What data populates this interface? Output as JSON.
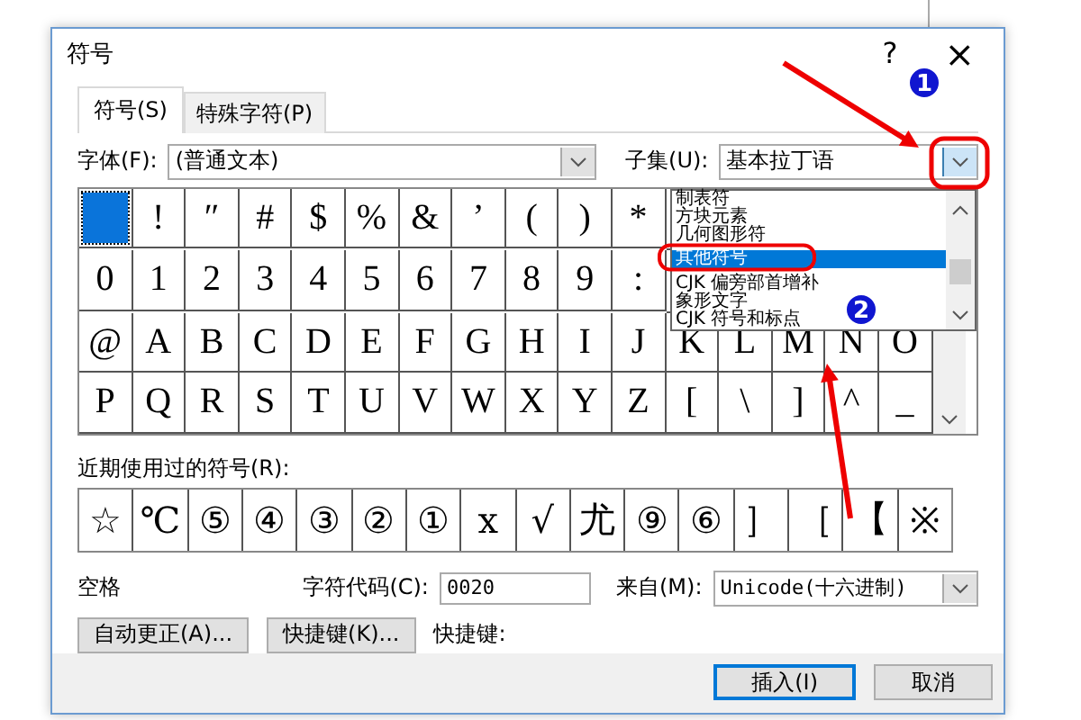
{
  "window": {
    "title": "符号",
    "help": "?",
    "close": "×"
  },
  "tabs": [
    {
      "label": "符号(S)",
      "selected": true
    },
    {
      "label": "特殊字符(P)",
      "selected": false
    }
  ],
  "font": {
    "label": "字体(F):",
    "value": "(普通文本)"
  },
  "subset": {
    "label": "子集(U):",
    "value": "基本拉丁语",
    "expanded": true,
    "options": [
      {
        "label": "制表符",
        "selected": false
      },
      {
        "label": "方块元素",
        "selected": false
      },
      {
        "label": "几何图形符",
        "selected": false
      },
      {
        "label": "其他符号",
        "selected": true
      },
      {
        "label": "CJK 偏旁部首增补",
        "selected": false
      },
      {
        "label": "象形文字",
        "selected": false
      },
      {
        "label": "CJK 符号和标点",
        "selected": false
      }
    ]
  },
  "symbol_grid": [
    [
      {
        "selected": true
      },
      {
        "char": "!",
        "selected": false
      },
      {
        "char": "″",
        "selected": false
      },
      {
        "char": "#",
        "selected": false
      },
      {
        "char": "$",
        "selected": false
      },
      {
        "char": "%",
        "selected": false
      },
      {
        "char": "&",
        "selected": false
      },
      {
        "char": "’",
        "selected": false
      },
      {
        "char": "(",
        "selected": false
      },
      {
        "char": ")",
        "selected": false
      },
      {
        "char": "*",
        "selected": false
      }
    ],
    [
      {
        "char": "0",
        "selected": false
      },
      {
        "char": "1",
        "selected": false
      },
      {
        "char": "2",
        "selected": false
      },
      {
        "char": "3",
        "selected": false
      },
      {
        "char": "4",
        "selected": false
      },
      {
        "char": "5",
        "selected": false
      },
      {
        "char": "6",
        "selected": false
      },
      {
        "char": "7",
        "selected": false
      },
      {
        "char": "8",
        "selected": false
      },
      {
        "char": "9",
        "selected": false
      },
      {
        "char": ":",
        "selected": false
      }
    ],
    [
      {
        "char": "@",
        "selected": false
      },
      {
        "char": "A",
        "selected": false
      },
      {
        "char": "B",
        "selected": false
      },
      {
        "char": "C",
        "selected": false
      },
      {
        "char": "D",
        "selected": false
      },
      {
        "char": "E",
        "selected": false
      },
      {
        "char": "F",
        "selected": false
      },
      {
        "char": "G",
        "selected": false
      },
      {
        "char": "H",
        "selected": false
      },
      {
        "char": "I",
        "selected": false
      },
      {
        "char": "J",
        "selected": false
      },
      {
        "char": "K",
        "selected": false
      },
      {
        "char": "L",
        "selected": false
      },
      {
        "char": "M",
        "selected": false
      },
      {
        "char": "N",
        "selected": false
      },
      {
        "char": "O",
        "selected": false
      }
    ],
    [
      {
        "char": "P",
        "selected": false
      },
      {
        "char": "Q",
        "selected": false
      },
      {
        "char": "R",
        "selected": false
      },
      {
        "char": "S",
        "selected": false
      },
      {
        "char": "T",
        "selected": false
      },
      {
        "char": "U",
        "selected": false
      },
      {
        "char": "V",
        "selected": false
      },
      {
        "char": "W",
        "selected": false
      },
      {
        "char": "X",
        "selected": false
      },
      {
        "char": "Y",
        "selected": false
      },
      {
        "char": "Z",
        "selected": false
      },
      {
        "char": "[",
        "selected": false
      },
      {
        "char": "\\",
        "selected": false
      },
      {
        "char": "]",
        "selected": false
      },
      {
        "char": "^",
        "selected": false
      },
      {
        "char": "_",
        "selected": false
      }
    ]
  ],
  "recent": {
    "label": "近期使用过的符号(R):",
    "symbols": [
      "☆",
      "℃",
      "⑤",
      "④",
      "③",
      "②",
      "①",
      "x",
      "√",
      "尤",
      "⑨",
      "⑥",
      "］",
      "［",
      "【",
      "※"
    ]
  },
  "char_name": "空格",
  "char_code": {
    "label": "字符代码(C):",
    "value": "0020"
  },
  "from": {
    "label": "来自(M):",
    "value": "Unicode(十六进制)"
  },
  "buttons": [
    {
      "label": "自动更正(A)..."
    },
    {
      "label": "快捷键(K)..."
    }
  ],
  "shortcut_label": "快捷键:",
  "footer_buttons": [
    {
      "label": "插入(I)",
      "default": true
    },
    {
      "label": "取消",
      "default": false
    }
  ],
  "annotations": [
    {
      "number": "1"
    },
    {
      "number": "2"
    }
  ]
}
